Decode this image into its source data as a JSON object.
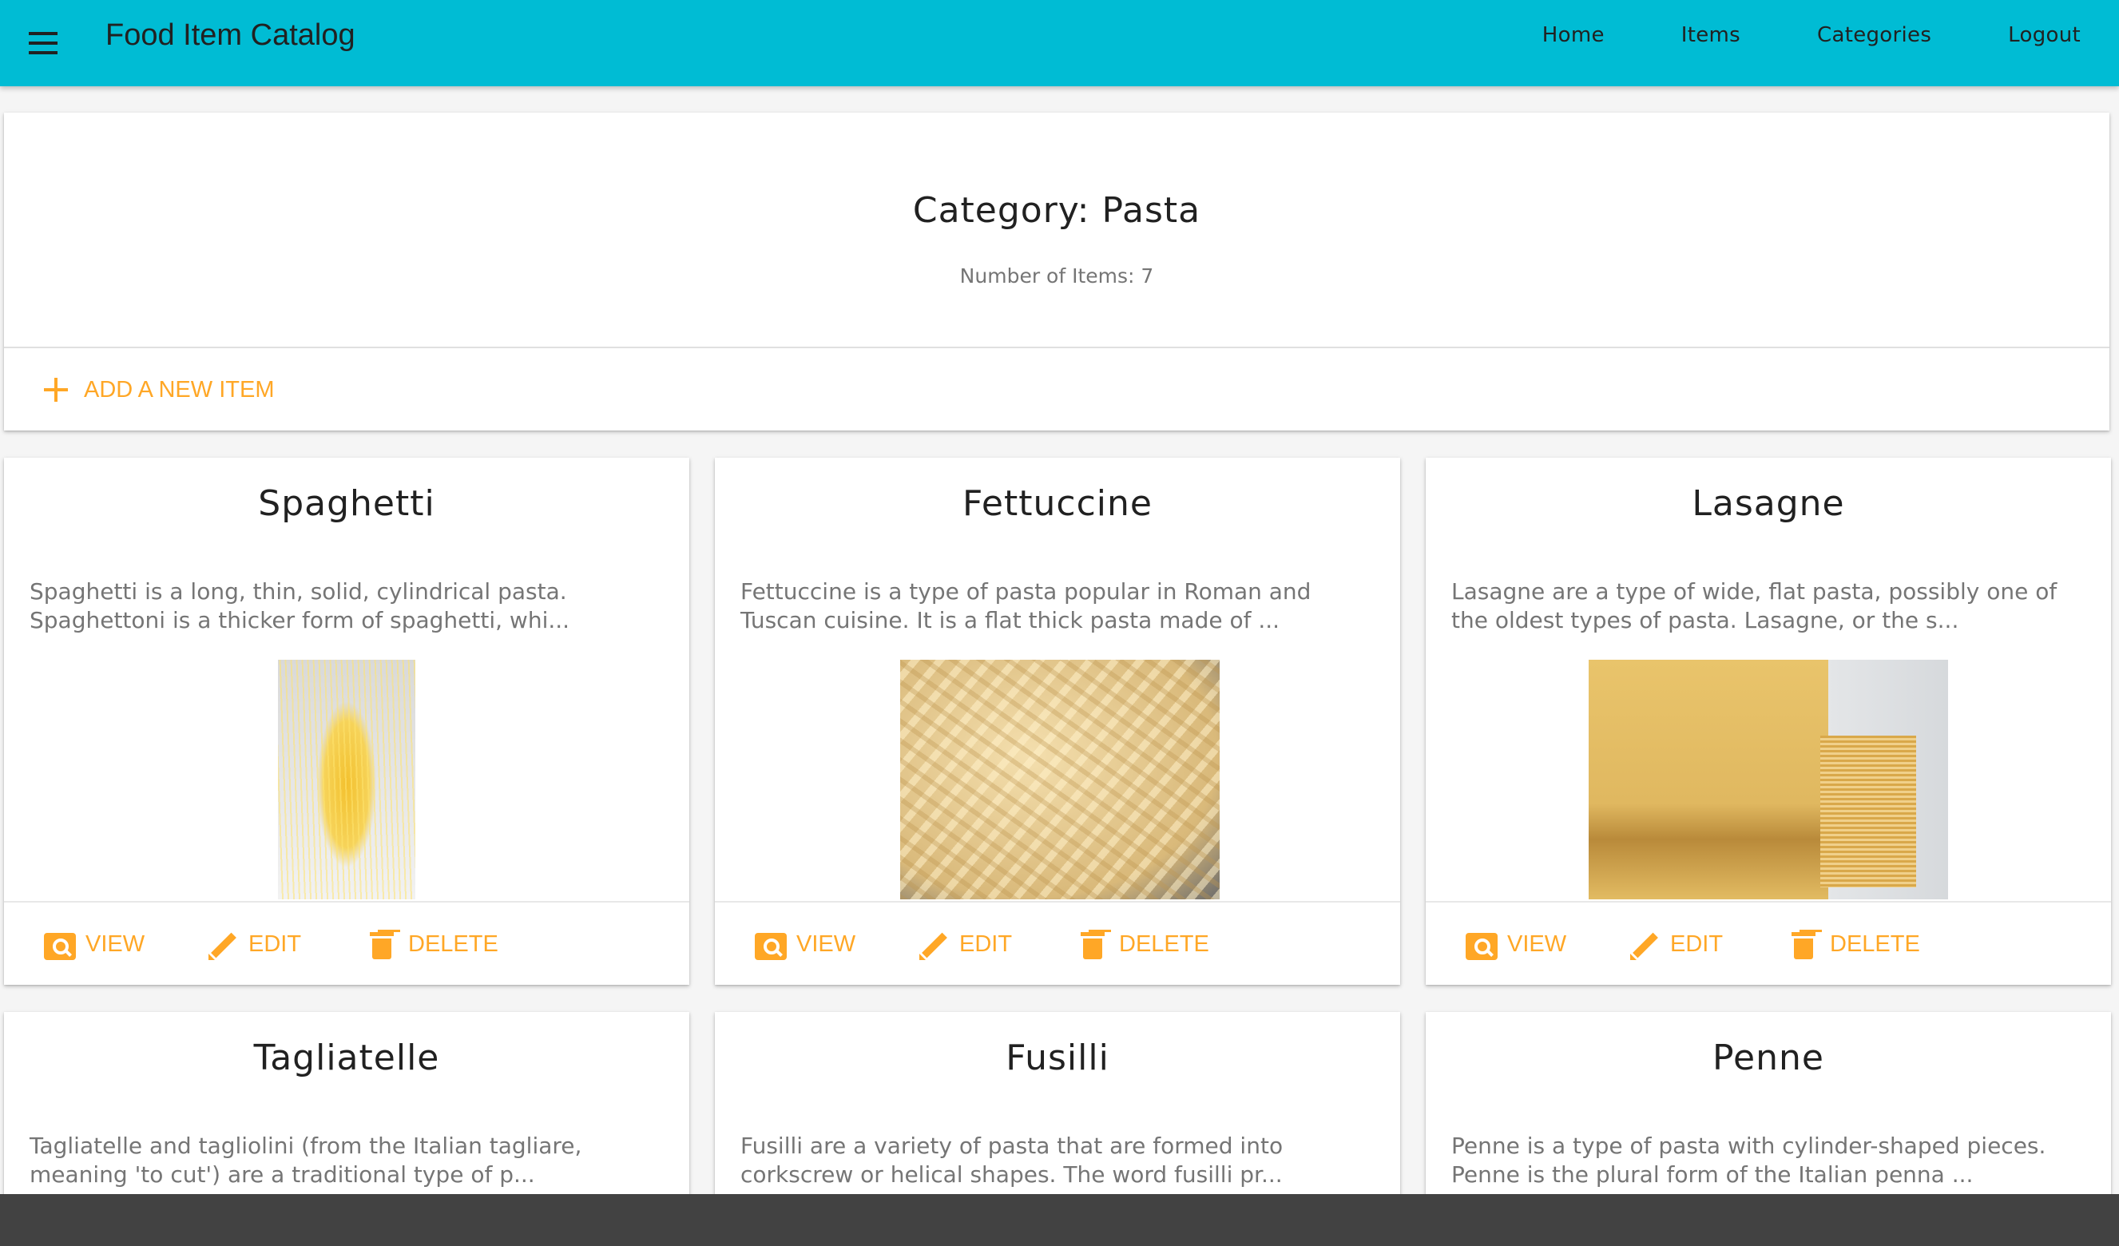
{
  "appbar": {
    "title": "Food Item Catalog",
    "nav": [
      "Home",
      "Items",
      "Categories",
      "Logout"
    ]
  },
  "header": {
    "title": "Category: Pasta",
    "count_label": "Number of Items: 7",
    "add_label": "ADD A NEW ITEM"
  },
  "actions": {
    "view": "VIEW",
    "edit": "EDIT",
    "delete": "DELETE"
  },
  "items": [
    {
      "name": "Spaghetti",
      "description": "Spaghetti is a long, thin, solid, cylindrical pasta. Spaghettoni is a thicker form of spaghetti, whi...",
      "image": "spaghetti-photo"
    },
    {
      "name": "Fettuccine",
      "description": "Fettuccine is a type of pasta popular in Roman and Tuscan cuisine. It is a flat thick pasta made of ...",
      "image": "fettuccine-photo"
    },
    {
      "name": "Lasagne",
      "description": "Lasagne are a type of wide, flat pasta, possibly one of the oldest types of pasta. Lasagne, or the s...",
      "image": "lasagne-photo"
    },
    {
      "name": "Tagliatelle",
      "description": "Tagliatelle and tagliolini (from the Italian tagliare, meaning 'to cut') are a traditional type of p..."
    },
    {
      "name": "Fusilli",
      "description": "Fusilli are a variety of pasta that are formed into corkscrew or helical shapes. The word fusilli pr..."
    },
    {
      "name": "Penne",
      "description": "Penne is a type of pasta with cylinder-shaped pieces. Penne is the plural form of the Italian penna ..."
    }
  ],
  "colors": {
    "appbar": "#00bcd4",
    "accent": "#ffa726",
    "bottom_bar": "#424242"
  }
}
